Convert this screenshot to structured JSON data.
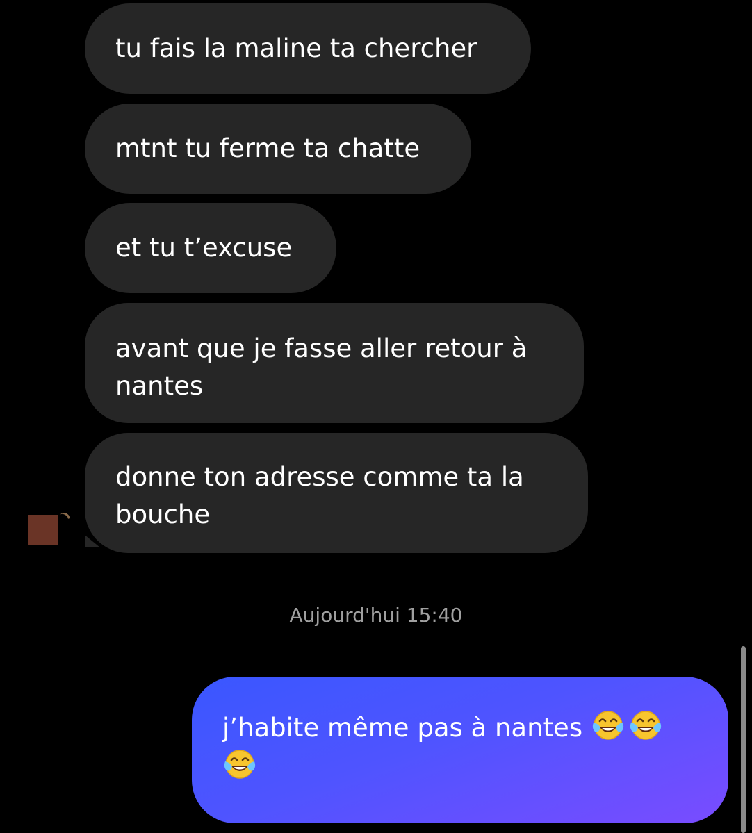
{
  "conversation": {
    "received": [
      {
        "lines": [
          "tu fais la maline ta chercher"
        ]
      },
      {
        "lines": [
          "mtnt tu ferme ta chatte"
        ]
      },
      {
        "lines": [
          "et tu t’excuse"
        ]
      },
      {
        "lines": [
          "avant que je fasse aller retour à",
          "nantes"
        ]
      },
      {
        "lines": [
          "donne ton adresse comme ta la",
          "bouche"
        ]
      }
    ],
    "timestamp": "Aujourd'hui 15:40",
    "sent": {
      "line1_text": "j’habite même pas à nantes ",
      "line1_emoji_count": 2,
      "line2_emoji_count": 1,
      "emoji": "face-with-tears-of-joy-icon"
    }
  },
  "colors": {
    "background": "#000000",
    "received_bubble": "#262626",
    "sent_bubble_start": "#3a57ff",
    "sent_bubble_end": "#7a4cff",
    "timestamp_text": "#a0a0a0",
    "avatar": "#6a3426"
  }
}
